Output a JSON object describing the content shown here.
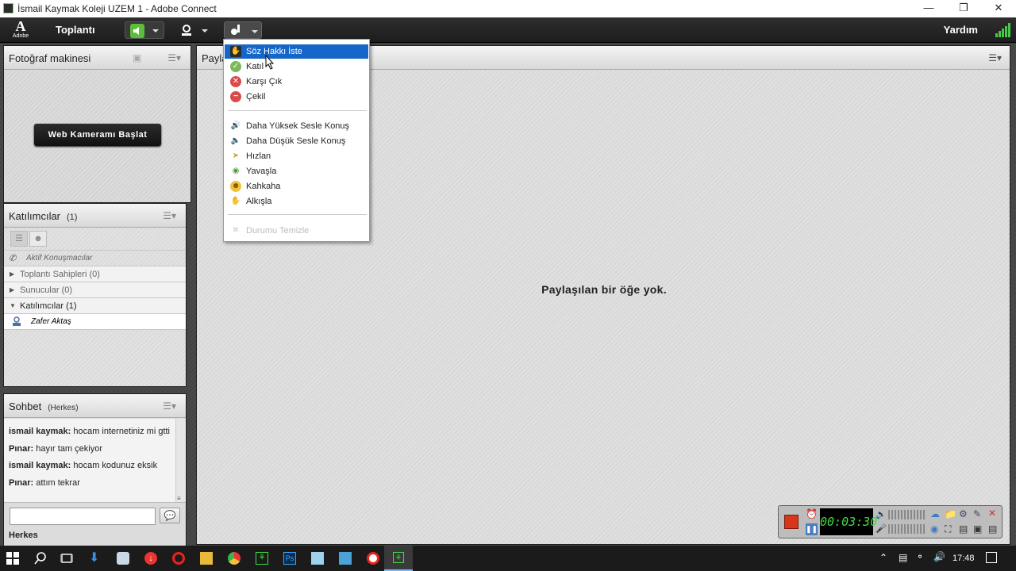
{
  "window": {
    "title": "İsmail Kaymak Koleji UZEM 1 - Adobe Connect"
  },
  "menubar": {
    "logo_text": "Adobe",
    "menu_title": "Toplantı",
    "help": "Yardım"
  },
  "camera_pod": {
    "title": "Fotoğraf makinesi",
    "start_button": "Web Kameramı Başlat"
  },
  "share_pod": {
    "title": "Payla",
    "empty_message": "Paylaşılan bir öğe yok."
  },
  "attendees_pod": {
    "title": "Katılımcılar",
    "count": "(1)",
    "active_speakers": "Aktif Konuşmacılar",
    "groups": [
      {
        "label": "Toplantı Sahipleri (0)",
        "expanded": false
      },
      {
        "label": "Sunucular (0)",
        "expanded": false
      },
      {
        "label": "Katılımcılar (1)",
        "expanded": true
      }
    ],
    "users": [
      "Zafer Aktaş"
    ]
  },
  "chat_pod": {
    "title": "Sohbet",
    "scope": "(Herkes)",
    "messages": [
      {
        "sender": "ismail kaymak:",
        "text": "hocam internetiniz mi gtti"
      },
      {
        "sender": "Pınar:",
        "text": "hayır tam çekiyor"
      },
      {
        "sender": "ismail kaymak:",
        "text": "hocam kodunuz eksik"
      },
      {
        "sender": "Pınar:",
        "text": "attım tekrar"
      }
    ],
    "recipient": "Herkes"
  },
  "status_menu": {
    "items": [
      {
        "label": "Söz Hakkı İste",
        "icon": "raise-hand-icon",
        "selected": true
      },
      {
        "label": "Katıl",
        "icon": "agree-icon"
      },
      {
        "label": "Karşı Çık",
        "icon": "disagree-icon"
      },
      {
        "label": "Çekil",
        "icon": "step-away-icon"
      }
    ],
    "items2": [
      {
        "label": "Daha Yüksek Sesle Konuş",
        "icon": "speak-louder-icon"
      },
      {
        "label": "Daha Düşük Sesle Konuş",
        "icon": "speak-softer-icon"
      },
      {
        "label": "Hızlan",
        "icon": "speed-up-icon"
      },
      {
        "label": "Yavaşla",
        "icon": "slow-down-icon"
      },
      {
        "label": "Kahkaha",
        "icon": "laughter-icon"
      },
      {
        "label": "Alkışla",
        "icon": "applause-icon"
      }
    ],
    "clear": {
      "label": "Durumu Temizle",
      "icon": "clear-status-icon",
      "disabled": true
    }
  },
  "recorder": {
    "timer": "00:03:30"
  },
  "taskbar": {
    "clock": "17:48"
  }
}
